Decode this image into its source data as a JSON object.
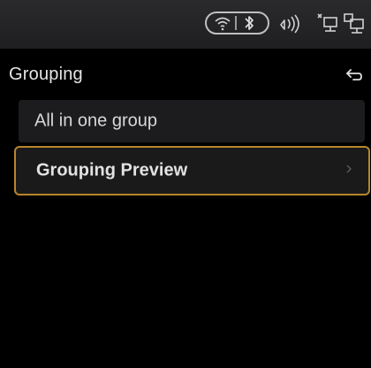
{
  "status_bar": {
    "icons": [
      "wifi-icon",
      "bluetooth-icon",
      "sound-icon",
      "network-disconnected-icon",
      "network-icon"
    ]
  },
  "header": {
    "title": "Grouping",
    "back_icon": "back-arrow-icon"
  },
  "menu": {
    "items": [
      {
        "label": "All in one group",
        "selected": false,
        "has_chevron": false
      },
      {
        "label": "Grouping Preview",
        "selected": true,
        "has_chevron": true
      }
    ]
  },
  "colors": {
    "background": "#000000",
    "row_background": "#1c1c1e",
    "focus_border": "#b8862c",
    "text": "#e6e6e6"
  }
}
